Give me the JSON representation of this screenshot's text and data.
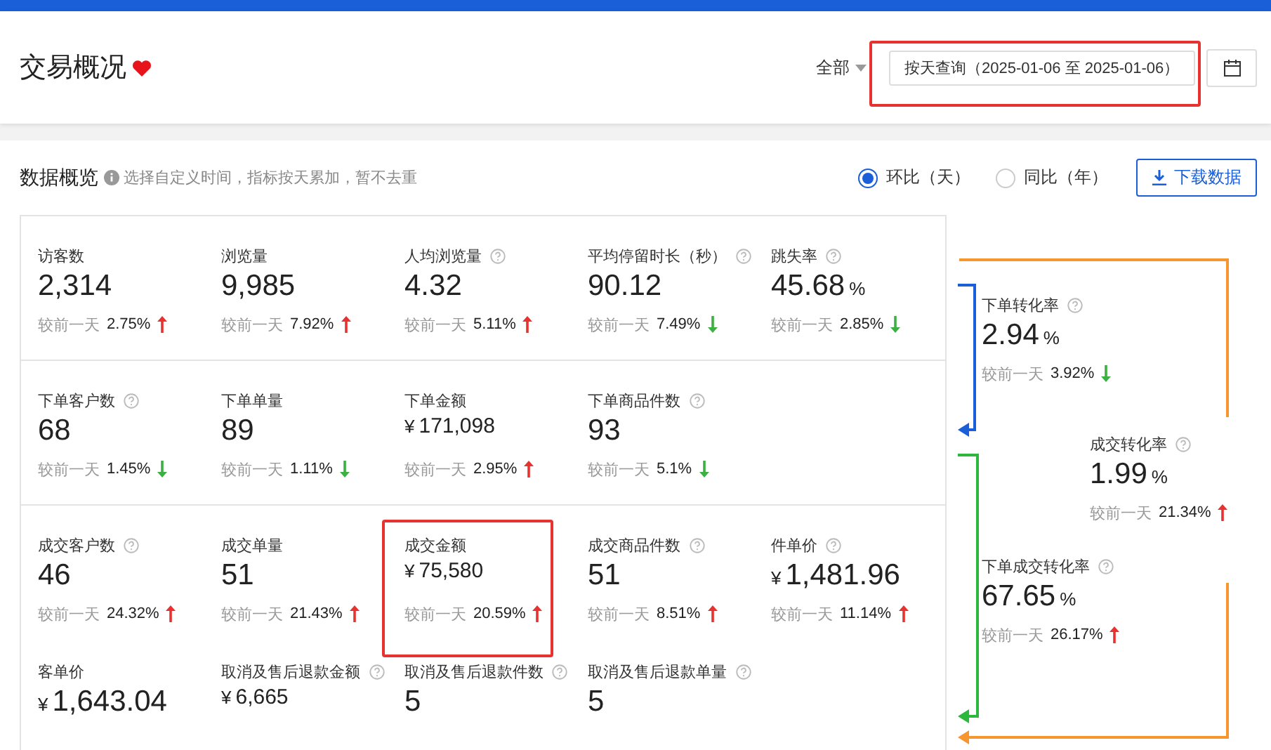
{
  "header": {
    "title": "交易概况",
    "shop_select": {
      "value": "全部"
    },
    "date_query": {
      "value": "按天查询（2025-01-06 至 2025-01-06）",
      "highlighted": true
    }
  },
  "overview": {
    "title": "数据概览",
    "hint": "选择自定义时间，指标按天累加，暂不去重",
    "compare_modes": [
      {
        "label": "环比（天）",
        "selected": true
      },
      {
        "label": "同比（年）",
        "selected": false
      }
    ],
    "download_button": "下载数据",
    "metric_groups": [
      [
        {
          "label": "访客数",
          "value": "2,314",
          "help": false,
          "compare_label": "较前一天",
          "change": "2.75%",
          "rising": true
        },
        {
          "label": "浏览量",
          "value": "9,985",
          "help": false,
          "compare_label": "较前一天",
          "change": "7.92%",
          "rising": true
        },
        {
          "label": "人均浏览量",
          "value": "4.32",
          "help": true,
          "compare_label": "较前一天",
          "change": "5.11%",
          "rising": true
        },
        {
          "label": "平均停留时长（秒）",
          "value": "90.12",
          "help": true,
          "compare_label": "较前一天",
          "change": "7.49%",
          "rising": false
        },
        {
          "label": "跳失率",
          "value": "45.68",
          "unit": "%",
          "help": true,
          "compare_label": "较前一天",
          "change": "2.85%",
          "rising": false
        }
      ],
      [
        {
          "label": "下单客户数",
          "value": "68",
          "help": true,
          "compare_label": "较前一天",
          "change": "1.45%",
          "rising": false
        },
        {
          "label": "下单单量",
          "value": "89",
          "help": false,
          "compare_label": "较前一天",
          "change": "1.11%",
          "rising": false
        },
        {
          "label": "下单金额",
          "currency": "¥",
          "value": "171,098",
          "compact": true,
          "help": false,
          "compare_label": "较前一天",
          "change": "2.95%",
          "rising": true
        },
        {
          "label": "下单商品件数",
          "value": "93",
          "help": true,
          "compare_label": "较前一天",
          "change": "5.1%",
          "rising": false
        }
      ],
      [
        {
          "label": "成交客户数",
          "value": "46",
          "help": true,
          "compare_label": "较前一天",
          "change": "24.32%",
          "rising": true
        },
        {
          "label": "成交单量",
          "value": "51",
          "help": false,
          "compare_label": "较前一天",
          "change": "21.43%",
          "rising": true
        },
        {
          "label": "成交金额",
          "currency": "¥",
          "value": "75,580",
          "compact": true,
          "help": false,
          "compare_label": "较前一天",
          "change": "20.59%",
          "rising": true,
          "highlighted": true
        },
        {
          "label": "成交商品件数",
          "value": "51",
          "help": true,
          "compare_label": "较前一天",
          "change": "8.51%",
          "rising": true
        },
        {
          "label": "件单价",
          "currency": "¥",
          "value": "1,481.96",
          "help": true,
          "compare_label": "较前一天",
          "change": "11.14%",
          "rising": true
        },
        {
          "label": "客单价",
          "currency": "¥",
          "value": "1,643.04",
          "help": false
        },
        {
          "label": "取消及售后退款金额",
          "currency": "¥",
          "value": "6,665",
          "compact": true,
          "help": true
        },
        {
          "label": "取消及售后退款件数",
          "value": "5",
          "help": true
        },
        {
          "label": "取消及售后退款单量",
          "value": "5",
          "help": true
        }
      ]
    ],
    "funnel": [
      {
        "label": "下单转化率",
        "value": "2.94",
        "unit": "%",
        "help": true,
        "compare_label": "较前一天",
        "change": "3.92%",
        "rising": false
      },
      {
        "label": "成交转化率",
        "value": "1.99",
        "unit": "%",
        "help": true,
        "compare_label": "较前一天",
        "change": "21.34%",
        "rising": true
      },
      {
        "label": "下单成交转化率",
        "value": "67.65",
        "unit": "%",
        "help": true,
        "compare_label": "较前一天",
        "change": "26.17%",
        "rising": true
      }
    ]
  }
}
